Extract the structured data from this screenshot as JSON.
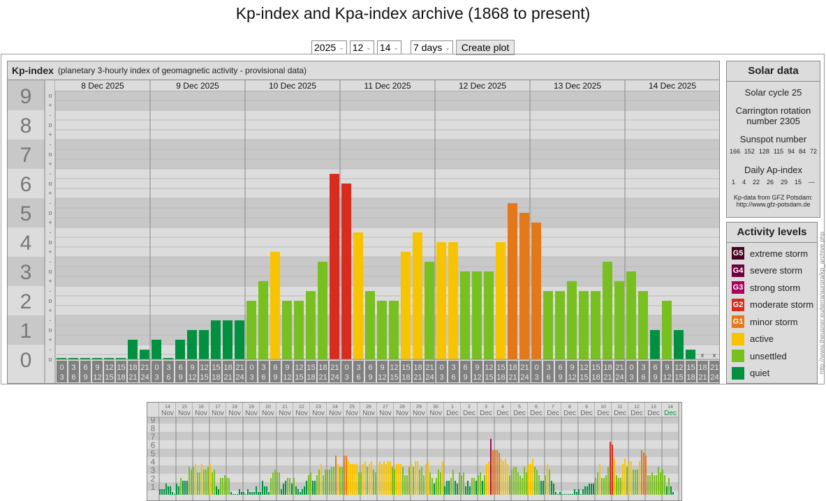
{
  "title": "Kp-index and Kpa-index archive (1868 to present)",
  "controls": {
    "year": "2025",
    "month": "12",
    "day": "14",
    "range": "7 days",
    "create_label": "Create plot"
  },
  "kp_header": {
    "title": "Kp-index",
    "subtitle": "(planetary 3-hourly index of geomagnetic activity - provisional data)"
  },
  "solar": {
    "title": "Solar data",
    "cycle": "Solar cycle 25",
    "carrington": "Carrington rotation number 2305",
    "sunspot_label": "Sunspot number",
    "sunspots": [
      "166",
      "152",
      "128",
      "115",
      "94",
      "84",
      "72"
    ],
    "ap_label": "Daily Ap-index",
    "ap": [
      "1",
      "4",
      "22",
      "26",
      "29",
      "15",
      "---"
    ],
    "source": "Kp-data from GFZ Potsdam:",
    "source_url": "http://www.gfz-potsdam.de"
  },
  "activity": {
    "title": "Activity levels",
    "items": [
      {
        "badge": "G5",
        "label": "extreme storm",
        "color": "#4a0020"
      },
      {
        "badge": "G4",
        "label": "severe storm",
        "color": "#700040"
      },
      {
        "badge": "G3",
        "label": "strong storm",
        "color": "#a8005c"
      },
      {
        "badge": "G2",
        "label": "moderate storm",
        "color": "#d82c1e"
      },
      {
        "badge": "G1",
        "label": "minor storm",
        "color": "#e47818"
      },
      {
        "badge": "",
        "label": "active",
        "color": "#f8c400"
      },
      {
        "badge": "",
        "label": "unsettled",
        "color": "#78c020"
      },
      {
        "badge": "",
        "label": "quiet",
        "color": "#009140"
      }
    ]
  },
  "vertical_url": "http://www.theusner.eu/terra/aurora/kp_archive.php",
  "chart_data": [
    {
      "type": "bar",
      "title": "Kp-index",
      "ylim": [
        0,
        9
      ],
      "yticks": [
        "0",
        "1",
        "2",
        "3",
        "4",
        "5",
        "6",
        "7",
        "8",
        "9"
      ],
      "subticks": [
        "o",
        "-",
        "+"
      ],
      "categories": [
        "8 Dec 2025",
        "9 Dec 2025",
        "10 Dec 2025",
        "11 Dec 2025",
        "12 Dec 2025",
        "13 Dec 2025",
        "14 Dec 2025"
      ],
      "hour_labels": [
        [
          "0",
          "3"
        ],
        [
          "3",
          "6"
        ],
        [
          "6",
          "9"
        ],
        [
          "9",
          "12"
        ],
        [
          "12",
          "15"
        ],
        [
          "15",
          "18"
        ],
        [
          "18",
          "21"
        ],
        [
          "21",
          "24"
        ]
      ],
      "missing_mark": "x",
      "values": [
        [
          0,
          0,
          0,
          0,
          0,
          0,
          0.67,
          0.33
        ],
        [
          0.67,
          0,
          0.67,
          1,
          1,
          1.33,
          1.33,
          1.33
        ],
        [
          2,
          2.67,
          3.67,
          2,
          2,
          2.33,
          3.33,
          6.33
        ],
        [
          6,
          4.33,
          2.33,
          2,
          2,
          3.67,
          4.33,
          3.33
        ],
        [
          4,
          4,
          3,
          3,
          3,
          4,
          5.33,
          5
        ],
        [
          4.67,
          2.33,
          2.33,
          2.67,
          2.33,
          2.33,
          3.33,
          2.67
        ],
        [
          3,
          2.33,
          1,
          2,
          1,
          0.33,
          null,
          null
        ]
      ]
    },
    {
      "type": "bar",
      "title": "30-day Kp overview",
      "ylim": [
        0,
        9
      ],
      "yticks": [
        "1",
        "2",
        "3",
        "4",
        "5",
        "6",
        "7",
        "8",
        "9"
      ],
      "categories": [
        [
          "14",
          "Nov"
        ],
        [
          "15",
          "Nov"
        ],
        [
          "16",
          "Nov"
        ],
        [
          "17",
          "Nov"
        ],
        [
          "18",
          "Nov"
        ],
        [
          "19",
          "Nov"
        ],
        [
          "20",
          "Nov"
        ],
        [
          "21",
          "Nov"
        ],
        [
          "22",
          "Nov"
        ],
        [
          "23",
          "Nov"
        ],
        [
          "24",
          "Nov"
        ],
        [
          "25",
          "Nov"
        ],
        [
          "26",
          "Nov"
        ],
        [
          "27",
          "Nov"
        ],
        [
          "28",
          "Nov"
        ],
        [
          "29",
          "Nov"
        ],
        [
          "30",
          "Nov"
        ],
        [
          "1",
          "Dec"
        ],
        [
          "2",
          "Dec"
        ],
        [
          "3",
          "Dec"
        ],
        [
          "4",
          "Dec"
        ],
        [
          "5",
          "Dec"
        ],
        [
          "6",
          "Dec"
        ],
        [
          "7",
          "Dec"
        ],
        [
          "8",
          "Dec"
        ],
        [
          "9",
          "Dec"
        ],
        [
          "10",
          "Dec"
        ],
        [
          "11",
          "Dec"
        ],
        [
          "12",
          "Dec"
        ],
        [
          "13",
          "Dec"
        ],
        [
          "14",
          "Dec"
        ]
      ],
      "values": [
        [
          0.67,
          0.67,
          0.67,
          1.33,
          1,
          1,
          0.33,
          0
        ],
        [
          1.33,
          1,
          2,
          1.67,
          1.67,
          1.67,
          3.33,
          3
        ],
        [
          3.33,
          3.67,
          2.67,
          2.67,
          3.67,
          3,
          3,
          3.33
        ],
        [
          3.67,
          2.67,
          3,
          1,
          0.67,
          2,
          2,
          2.33
        ],
        [
          2,
          2,
          0.33,
          0,
          0,
          0,
          0.67,
          0.33
        ],
        [
          0.33,
          0,
          0.67,
          0.33,
          0.33,
          0.33,
          1,
          0.33
        ],
        [
          0.33,
          1.67,
          1,
          1,
          0.33,
          2,
          2.67,
          3
        ],
        [
          2.67,
          2.67,
          0.67,
          1.33,
          1.67,
          2,
          2,
          1.33
        ],
        [
          2,
          1,
          0.67,
          0.33,
          0.67,
          1,
          1.67,
          2.33
        ],
        [
          2.67,
          1.67,
          1.67,
          2.33,
          3,
          3.67,
          2.33,
          3
        ],
        [
          3,
          3,
          3.33,
          3.33,
          4.67,
          3.67,
          3.33,
          3.33
        ],
        [
          4.67,
          4.67,
          4,
          3.67,
          3.67,
          3.67,
          3.67,
          2.67
        ],
        [
          2.67,
          3.67,
          4,
          3.33,
          3.67,
          4,
          3,
          2.67
        ],
        [
          3.67,
          4,
          3.67,
          4,
          3.67,
          4,
          4,
          3.33
        ],
        [
          3,
          3.67,
          3.67,
          3.67,
          3.33,
          2.33,
          2.33,
          3.33
        ],
        [
          3.67,
          3.33,
          4,
          4,
          3,
          3.33,
          2.33,
          3.67
        ],
        [
          4,
          2.67,
          2,
          1.33,
          2,
          3,
          2.67,
          4
        ],
        [
          1,
          1.67,
          1.67,
          2,
          3,
          1.67,
          1.33,
          2.67
        ],
        [
          2.33,
          2.67,
          1,
          1.67,
          1,
          2,
          2,
          1.67
        ],
        [
          2.33,
          2.67,
          1.67,
          2.33,
          3.67,
          4,
          6.67,
          5.33
        ],
        [
          5.33,
          5.33,
          5,
          4.33,
          4,
          4.33,
          3.67,
          2.33
        ],
        [
          3,
          3.33,
          3.33,
          2.67,
          2.33,
          2,
          3.33,
          2.67
        ],
        [
          3.67,
          3.67,
          4.33,
          3.33,
          3,
          2.33,
          1.67,
          1.67
        ],
        [
          2.33,
          3.67,
          3,
          1.67,
          1.33,
          0.33,
          0,
          0.33
        ],
        [
          0,
          0,
          0,
          0,
          0,
          0,
          0.67,
          0.33
        ],
        [
          0.67,
          0,
          0.67,
          1,
          1,
          1.33,
          1.33,
          1.33
        ],
        [
          2,
          2.67,
          3.67,
          2,
          2,
          2.33,
          3.33,
          6.33
        ],
        [
          6,
          4.33,
          2.33,
          2,
          2,
          3.67,
          4.33,
          3.33
        ],
        [
          4,
          4,
          3,
          3,
          3,
          4,
          5.33,
          5
        ],
        [
          4.67,
          2.33,
          2.33,
          2.67,
          2.33,
          2.33,
          3.33,
          2.67
        ],
        [
          3,
          2.33,
          1,
          2,
          1,
          0.33,
          null,
          null
        ]
      ],
      "highlight_day_color": "#009140"
    }
  ]
}
